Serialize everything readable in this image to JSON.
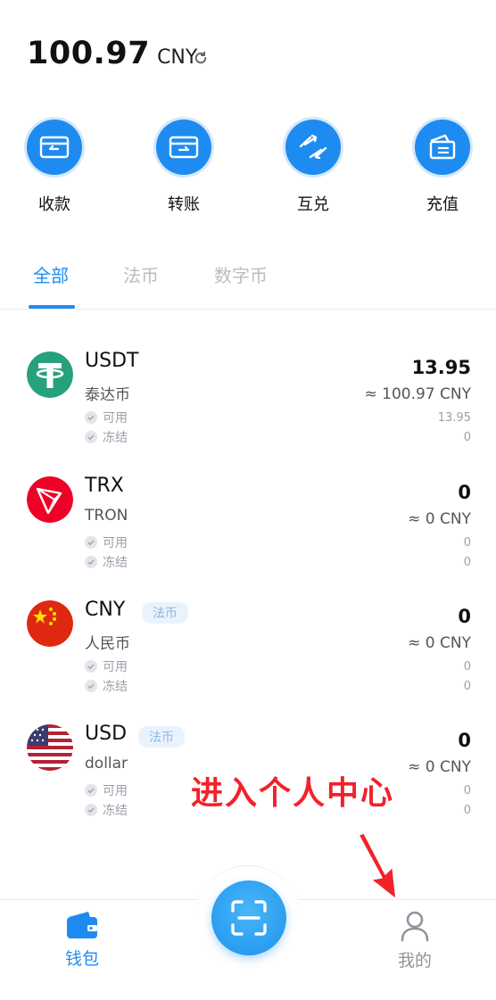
{
  "balance": {
    "amount": "100.97",
    "unit": "CNY"
  },
  "actions": [
    {
      "label": "收款",
      "icon": "receive-icon"
    },
    {
      "label": "转账",
      "icon": "transfer-icon"
    },
    {
      "label": "互兑",
      "icon": "exchange-icon"
    },
    {
      "label": "充值",
      "icon": "recharge-icon"
    }
  ],
  "tabs": [
    {
      "label": "全部",
      "active": true
    },
    {
      "label": "法币",
      "active": false
    },
    {
      "label": "数字币",
      "active": false
    }
  ],
  "assets": [
    {
      "symbol": "USDT",
      "name": "泰达币",
      "badge": "",
      "amount": "13.95",
      "fiat": "≈ 100.97 CNY",
      "available_label": "可用",
      "frozen_label": "冻结",
      "available": "13.95",
      "frozen": "0"
    },
    {
      "symbol": "TRX",
      "name": "TRON",
      "badge": "",
      "amount": "0",
      "fiat": "≈ 0 CNY",
      "available_label": "可用",
      "frozen_label": "冻结",
      "available": "0",
      "frozen": "0"
    },
    {
      "symbol": "CNY",
      "name": "人民币",
      "badge": "法币",
      "amount": "0",
      "fiat": "≈ 0 CNY",
      "available_label": "可用",
      "frozen_label": "冻结",
      "available": "0",
      "frozen": "0"
    },
    {
      "symbol": "USD",
      "name": "dollar",
      "badge": "法币",
      "amount": "0",
      "fiat": "≈ 0 CNY",
      "available_label": "可用",
      "frozen_label": "冻结",
      "available": "0",
      "frozen": "0"
    }
  ],
  "annotation": "进入个人中心",
  "bottom_nav": {
    "wallet_label": "钱包",
    "profile_label": "我的"
  },
  "colors": {
    "accent": "#1e8bf0",
    "annotation": "#f2222a",
    "tether": "#26a17b",
    "tron": "#ef0027"
  }
}
